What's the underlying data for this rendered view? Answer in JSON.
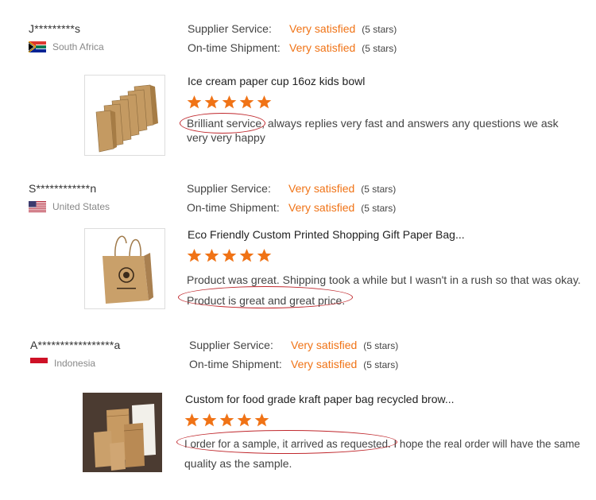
{
  "labels": {
    "supplier_service": "Supplier Service:",
    "on_time_shipment": "On-time Shipment:"
  },
  "reviews": [
    {
      "name": "J*********s",
      "country": "South Africa",
      "supplier_service": "Very satisfied",
      "supplier_stars": "(5 stars)",
      "shipment": "Very satisfied",
      "shipment_stars": "(5 stars)",
      "product_title": "Ice cream paper cup 16oz kids bowl",
      "rating": 5,
      "comment_line1": "Brilliant service, always replies very fast and answers any questions  we ask",
      "comment_line2": "very very happy",
      "product_icon": "kraft-paper-bags-row"
    },
    {
      "name": "S************n",
      "country": "United States",
      "supplier_service": "Very satisfied",
      "supplier_stars": "(5 stars)",
      "shipment": "Very satisfied",
      "shipment_stars": "(5 stars)",
      "product_title": "Eco Friendly Custom Printed Shopping Gift Paper Bag...",
      "rating": 5,
      "comment_line1": "Product was great. Shipping took a while but I wasn't in a rush so that was okay.",
      "comment_line2": "Product is  great and great price.",
      "product_icon": "kraft-shopping-bag-with-handles"
    },
    {
      "name": "A*****************a",
      "country": "Indonesia",
      "supplier_service": "Very satisfied",
      "supplier_stars": "(5 stars)",
      "shipment": "Very satisfied",
      "shipment_stars": "(5 stars)",
      "product_title": "Custom for food grade kraft paper bag recycled brow...",
      "rating": 5,
      "comment_line1": "I order for a sample, it arrived as requested. I hope the real order will have the same",
      "comment_line2": "quality  as the sample.",
      "product_icon": "food-grade-kraft-bags"
    }
  ],
  "colors": {
    "accent_orange": "#f07316",
    "annotation_red": "#c0282d"
  }
}
